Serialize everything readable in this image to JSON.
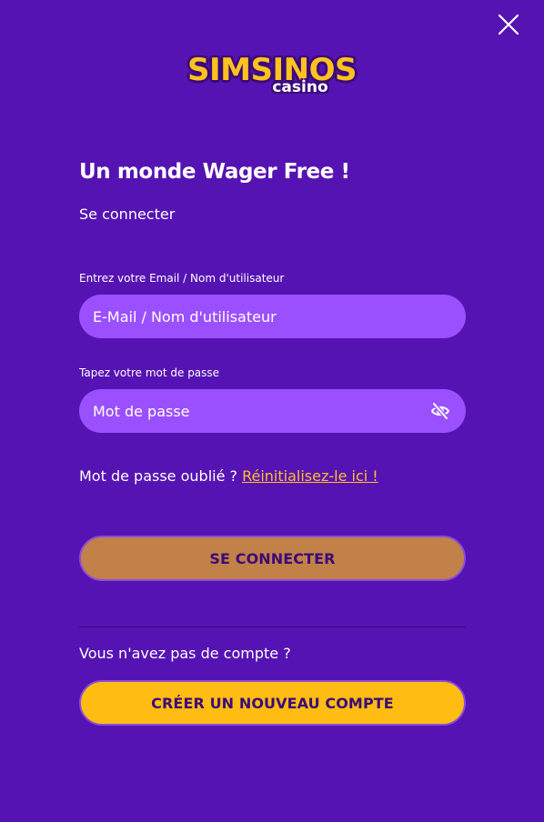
{
  "logo": {
    "top": "SIMSINOS",
    "bottom": "casino"
  },
  "header": {
    "title": "Un monde Wager Free !",
    "subtitle": "Se connecter"
  },
  "form": {
    "email_label": "Entrez votre Email / Nom d'utilisateur",
    "email_placeholder": "E-Mail / Nom d'utilisateur",
    "password_label": "Tapez votre mot de passe",
    "password_placeholder": "Mot de passe",
    "forgot_text": "Mot de passe oublié ?",
    "forgot_link": "Réinitialisez-le ici !",
    "login_button": "SE CONNECTER"
  },
  "register": {
    "prompt": "Vous n'avez pas de compte ?",
    "create_button": "CRÉER UN NOUVEAU COMPTE"
  },
  "icons": {
    "close": "close-icon",
    "password_toggle": "eye-slash-icon"
  },
  "colors": {
    "background": "#5613b3",
    "input_bg": "#9b50ff",
    "accent_yellow": "#ffbc12",
    "login_button_bg": "#c18148",
    "button_text": "#3b0a78"
  }
}
